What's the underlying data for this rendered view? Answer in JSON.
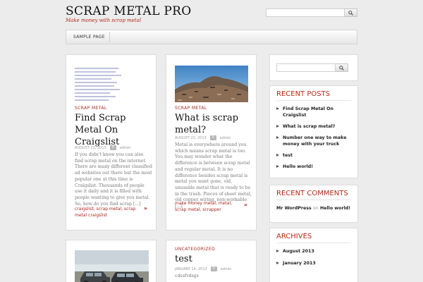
{
  "site": {
    "title": "SCRAP METAL PRO",
    "tagline": "Make money with scrap metal"
  },
  "nav": {
    "items": [
      {
        "label": "SAMPLE PAGE"
      }
    ]
  },
  "search": {
    "top_value": "",
    "side_value": ""
  },
  "posts": [
    {
      "category": "SCRAP METAL",
      "title": "Find Scrap Metal On Craigslist",
      "date": "AUGUST 22, 2013",
      "comments": "0",
      "author": "admin",
      "excerpt": "If you didn't know you can also find scrap metal on the internet. There are many different classified ad websites out there but the most popular one at this time is Craigslist. Thousands of people use it daily and it is filled with people wanting to give you metal. So, how do you find scrap [...]",
      "tags": "craigslist, scrap metal, scrap metal craigslist",
      "more": "»"
    },
    {
      "category": "SCRAP METAL",
      "title": "What is scrap metal?",
      "date": "AUGUST 20, 2013",
      "comments": "0",
      "author": "admin",
      "excerpt": "Metal is everywhere around you which means scrap metal is too. You may wonder what the difference is between scrap metal and regular metal. It is no difference besides scrap metal is metal you want gone, old, unusable metal that is ready to be in the trash. Pieces of sheet metal, old copper wiring, non-workable [...]",
      "tags": "make money metal, metal, scrap metal, scrapper",
      "more": "»"
    },
    {
      "category": "",
      "title": "",
      "date": "",
      "comments": "",
      "author": "",
      "excerpt": "",
      "tags": "",
      "more": ""
    },
    {
      "category": "UNCATEGORIZED",
      "title": "test",
      "date": "JANUARY 14, 2013",
      "comments": "0",
      "author": "admin",
      "excerpt": "cdssfvdsgs",
      "tags": "",
      "more": ""
    }
  ],
  "sidebar": {
    "recent_posts": {
      "title": "RECENT POSTS",
      "items": [
        "Find Scrap Metal On Craigslist",
        "What is scrap metal?",
        "Number one way to make money with your truck",
        "test",
        "Hello world!"
      ]
    },
    "recent_comments": {
      "title": "RECENT COMMENTS",
      "author": "Mr WordPress",
      "on": "on",
      "post": "Hello world!"
    },
    "archives": {
      "title": "ARCHIVES",
      "items": [
        "August 2013",
        "January 2013"
      ]
    }
  },
  "colors": {
    "accent": "#b32a1a",
    "link": "#a8261c",
    "background": "#ececec"
  },
  "icons": {
    "search": "search-icon",
    "comment": "comment-bubble-icon",
    "bullet": "triangle-bullet-icon"
  }
}
